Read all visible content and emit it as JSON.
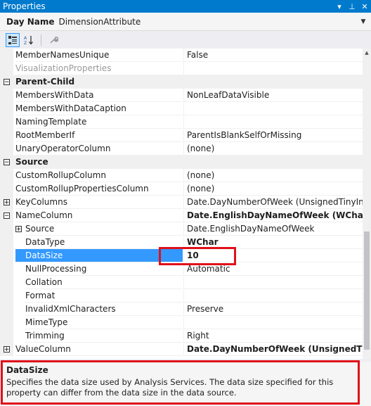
{
  "window": {
    "title": "Properties",
    "btn_dropdown": "▾",
    "btn_pin": "⊥",
    "btn_close": "✕"
  },
  "object": {
    "name_bold": "Day Name",
    "type": "DimensionAttribute"
  },
  "toolbar": {
    "categorized_icon": "categorized-icon",
    "alphabetical_icon": "alphabetical-icon",
    "property_pages_icon": "wrench-icon"
  },
  "grid": {
    "rows": [
      {
        "kind": "prop",
        "name": "MemberNamesUnique",
        "value": "False"
      },
      {
        "kind": "dim",
        "name": "VisualizationProperties",
        "value": ""
      },
      {
        "kind": "cat",
        "name": "Parent-Child"
      },
      {
        "kind": "prop",
        "name": "MembersWithData",
        "value": "NonLeafDataVisible"
      },
      {
        "kind": "prop",
        "name": "MembersWithDataCaption",
        "value": ""
      },
      {
        "kind": "prop",
        "name": "NamingTemplate",
        "value": ""
      },
      {
        "kind": "prop",
        "name": "RootMemberIf",
        "value": "ParentIsBlankSelfOrMissing"
      },
      {
        "kind": "prop",
        "name": "UnaryOperatorColumn",
        "value": "(none)"
      },
      {
        "kind": "cat",
        "name": "Source"
      },
      {
        "kind": "prop",
        "name": "CustomRollupColumn",
        "value": "(none)"
      },
      {
        "kind": "prop",
        "name": "CustomRollupPropertiesColumn",
        "value": "(none)"
      },
      {
        "kind": "exp",
        "name": "KeyColumns",
        "value": "Date.DayNumberOfWeek (UnsignedTinyInt)"
      },
      {
        "kind": "col",
        "name": "NameColumn",
        "value": "Date.EnglishDayNameOfWeek (WChar)"
      },
      {
        "kind": "subexp",
        "name": "Source",
        "value": "Date.EnglishDayNameOfWeek"
      },
      {
        "kind": "sub",
        "name": "DataType",
        "value": "WChar",
        "bold": true
      },
      {
        "kind": "sel",
        "name": "DataSize",
        "value": "10",
        "bold": true
      },
      {
        "kind": "sub",
        "name": "NullProcessing",
        "value": "Automatic"
      },
      {
        "kind": "sub",
        "name": "Collation",
        "value": ""
      },
      {
        "kind": "sub",
        "name": "Format",
        "value": ""
      },
      {
        "kind": "sub",
        "name": "InvalidXmlCharacters",
        "value": "Preserve"
      },
      {
        "kind": "sub",
        "name": "MimeType",
        "value": ""
      },
      {
        "kind": "sub",
        "name": "Trimming",
        "value": "Right"
      },
      {
        "kind": "exp",
        "name": "ValueColumn",
        "value": "Date.DayNumberOfWeek (UnsignedTinyInt)",
        "bold": true
      }
    ]
  },
  "description": {
    "title": "DataSize",
    "text": "Specifies the data size used by Analysis Services. The data size specified for this property can differ from the data size in the data source."
  },
  "colors": {
    "title_bar": "#007acc",
    "selection": "#3399ff",
    "highlight": "#e0101a"
  }
}
